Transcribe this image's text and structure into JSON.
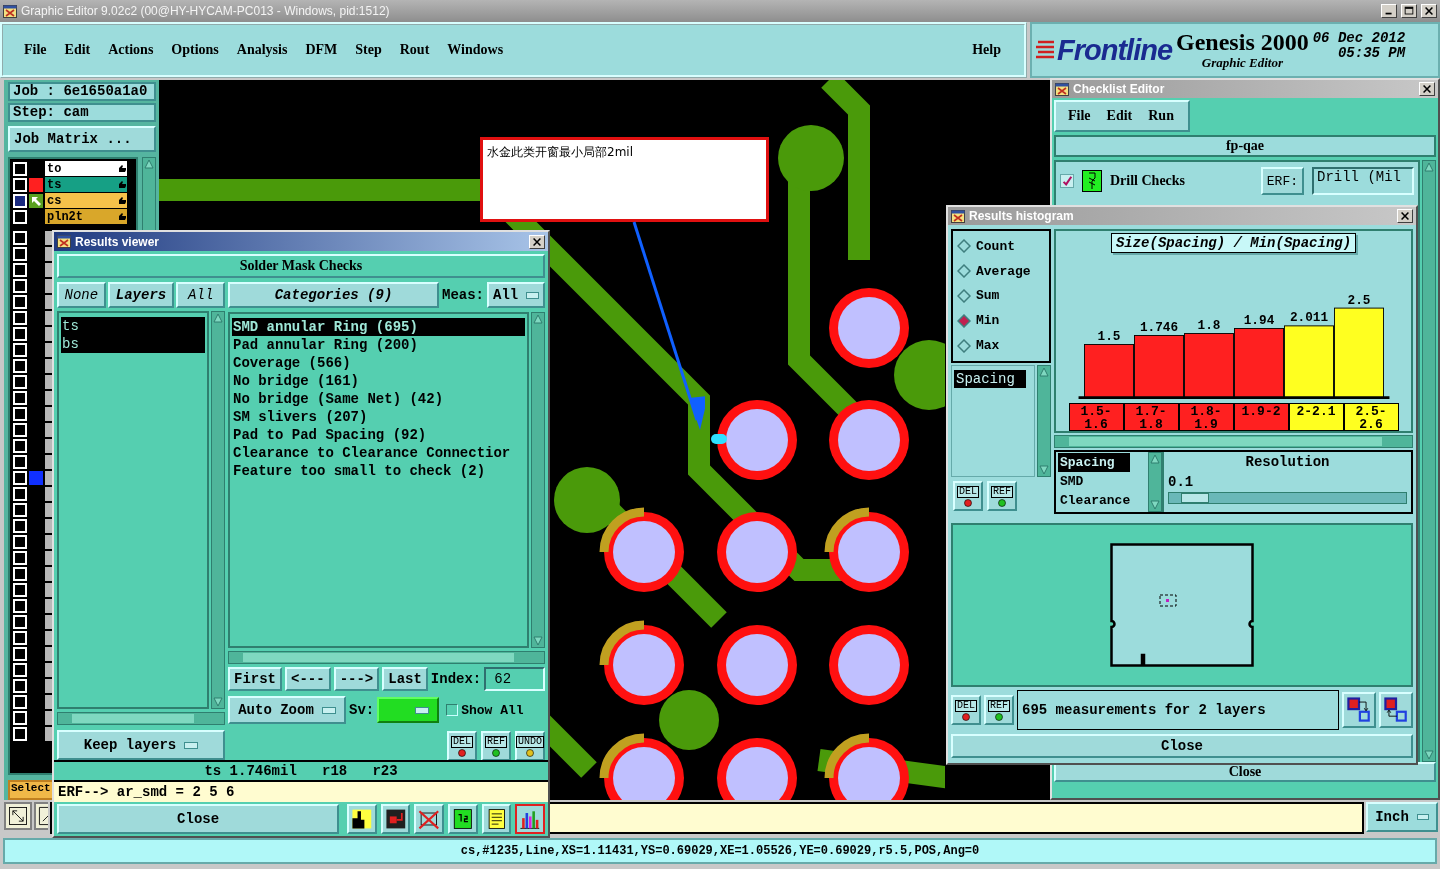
{
  "window": {
    "title": "Graphic Editor 9.02c2 (00@HY-HYCAM-PC013 - Windows, pid:1512)"
  },
  "menu": [
    "File",
    "Edit",
    "Actions",
    "Options",
    "Analysis",
    "DFM",
    "Step",
    "Rout",
    "Windows"
  ],
  "help_menu": "Help",
  "brand": {
    "logo": "Frontline",
    "product": "Genesis 2000",
    "subtitle": "Graphic Editor",
    "date": "06 Dec 2012",
    "time": "05:35 PM"
  },
  "job_panel": {
    "job": "Job :  6e1650a1a0",
    "step": "Step: cam",
    "job_matrix": "Job Matrix ...",
    "layers": [
      {
        "name": "to",
        "color": "#ffffff",
        "selected": false,
        "work": false
      },
      {
        "name": "ts",
        "color": "#16a085",
        "selected": false,
        "work": false,
        "marker": {
          "color": "#ff2020"
        }
      },
      {
        "name": "cs",
        "color": "#f5c24a",
        "selected": true,
        "work": true
      },
      {
        "name": "pln2t",
        "color": "#d9a72a",
        "selected": false,
        "work": false
      }
    ],
    "covered_layers": [
      {
        "selected": false
      },
      {
        "selected": false
      },
      {
        "selected": false
      },
      {
        "selected": false
      },
      {
        "selected": false
      },
      {
        "selected": false
      },
      {
        "selected": false
      },
      {
        "selected": false
      },
      {
        "selected": false
      },
      {
        "selected": false
      },
      {
        "selected": false
      },
      {
        "selected": false
      },
      {
        "selected": false
      },
      {
        "selected": false
      },
      {
        "selected": false
      },
      {
        "selected": false,
        "marker": {
          "color": "#1030ff"
        }
      },
      {
        "selected": false
      },
      {
        "selected": false
      },
      {
        "selected": false
      },
      {
        "selected": false
      },
      {
        "selected": false
      },
      {
        "selected": false
      },
      {
        "selected": false
      },
      {
        "selected": false
      },
      {
        "selected": false
      },
      {
        "selected": false
      },
      {
        "selected": false
      },
      {
        "selected": false
      },
      {
        "selected": false
      },
      {
        "selected": false
      },
      {
        "selected": false
      },
      {
        "selected": false
      }
    ],
    "select_button": "Select"
  },
  "note": "水金此类开窗最小局部2mil",
  "results_viewer": {
    "title": "Results viewer",
    "heading": "Solder Mask Checks",
    "layer_buttons": [
      "None",
      "Layers",
      "All"
    ],
    "layers": [
      {
        "name": "ts",
        "selected": true
      },
      {
        "name": "bs",
        "selected": true
      }
    ],
    "categories_button": "Categories (9)",
    "meas_label": "Meas:",
    "meas_value": "All",
    "categories": [
      {
        "text": "SMD annular Ring (695)",
        "selected": true
      },
      {
        "text": "Pad annular Ring (200)",
        "selected": false
      },
      {
        "text": "Coverage (566)",
        "selected": false
      },
      {
        "text": "No bridge (161)",
        "selected": false
      },
      {
        "text": "No bridge (Same Net) (42)",
        "selected": false
      },
      {
        "text": "SM slivers (207)",
        "selected": false
      },
      {
        "text": "Pad to Pad Spacing (92)",
        "selected": false
      },
      {
        "text": "Clearance to Clearance Connectior",
        "selected": false
      },
      {
        "text": "Feature too small to check (2)",
        "selected": false
      }
    ],
    "nav_buttons": [
      "First",
      "<---",
      "--->",
      "Last"
    ],
    "index_label": "Index:",
    "index_value": "62",
    "auto_zoom": "Auto Zoom",
    "sv_label": "Sv:",
    "show_all": {
      "label": "Show All",
      "checked": false
    },
    "keep_layers": "Keep layers",
    "action_buttons": [
      "DEL",
      "REF",
      "UNDO"
    ],
    "measurement": "ts 1.746mil   r18   r23",
    "erf": "ERF--> ar_smd = 2 5 6",
    "close": "Close"
  },
  "checklist_editor": {
    "title": "Checklist Editor",
    "menu": [
      "File",
      "Edit",
      "Run"
    ],
    "name": "fp-qae",
    "checks": [
      {
        "label": "Drill Checks",
        "checked": true,
        "erf_label": "ERF:",
        "erf_value": "Drill (Mil"
      }
    ],
    "close": "Close"
  },
  "histogram": {
    "title": "Results histogram",
    "modes": [
      {
        "label": "Count",
        "selected": false
      },
      {
        "label": "Average",
        "selected": false
      },
      {
        "label": "Sum",
        "selected": false
      },
      {
        "label": "Min",
        "selected": true
      },
      {
        "label": "Max",
        "selected": false
      }
    ],
    "attributes": [
      {
        "label": "Spacing",
        "selected": true
      }
    ],
    "buttons": [
      "DEL",
      "REF"
    ],
    "chart_data": {
      "type": "bar",
      "title": "Size(Spacing) / Min(Spacing)",
      "categories": [
        "1.5-1.6",
        "1.7-1.8",
        "1.8-1.9",
        "1.9-2",
        "2-2.1",
        "2.5-2.6"
      ],
      "series": [
        {
          "color": "#ff2020",
          "values": [
            1.5,
            1.746,
            1.8,
            1.94,
            null,
            null
          ]
        },
        {
          "color": "#ffff20",
          "values": [
            null,
            null,
            null,
            null,
            2.011,
            2.5
          ]
        }
      ],
      "data_labels": true
    },
    "sub_attributes": [
      {
        "label": "Spacing",
        "selected": true
      },
      {
        "label": "SMD",
        "selected": false
      },
      {
        "label": "Clearance",
        "selected": false
      }
    ],
    "resolution": {
      "label": "Resolution",
      "value": "0.1",
      "level": 0.05
    },
    "bottom_buttons": [
      "DEL",
      "REF"
    ],
    "status": "695 measurements for 2 layers",
    "close": "Close"
  },
  "units": "Inch",
  "status_line": "cs,#1235,Line,XS=1.11431,YS=0.69029,XE=1.05526,YE=0.69029,r5.5,POS,Ang=0"
}
